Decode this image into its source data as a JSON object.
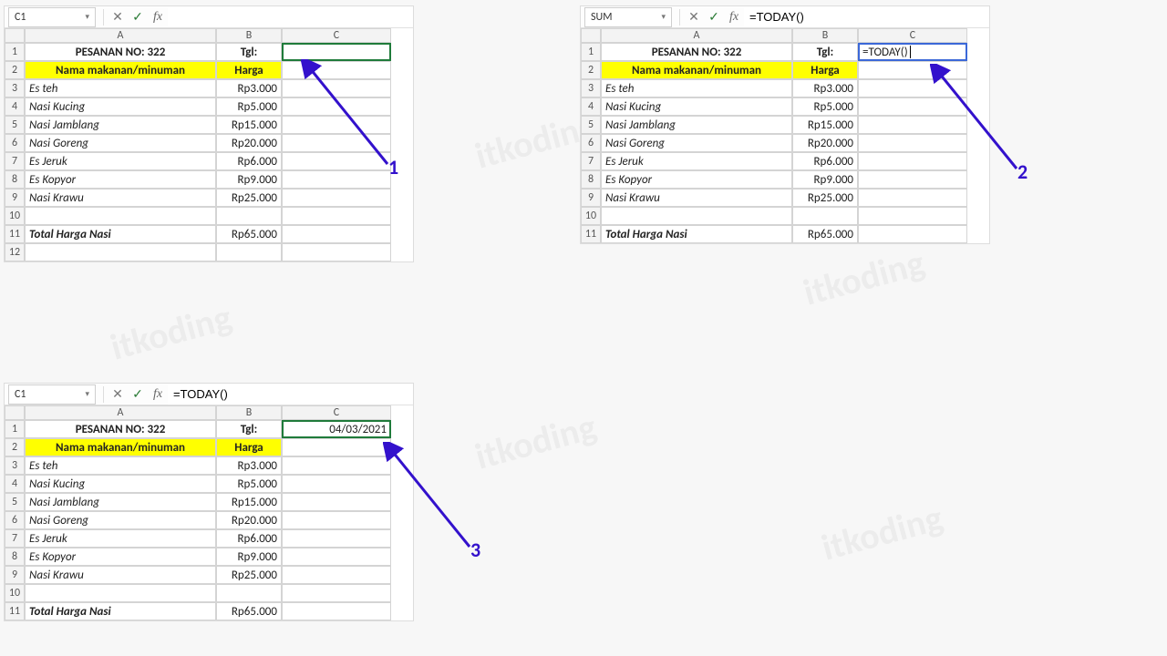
{
  "watermark": "itkoding",
  "panel1": {
    "namebox": "C1",
    "formula": "",
    "cols": [
      "A",
      "B",
      "C"
    ],
    "rows": [
      "1",
      "2",
      "3",
      "4",
      "5",
      "6",
      "7",
      "8",
      "9",
      "10",
      "11",
      "12"
    ],
    "r1": {
      "a": "PESANAN NO: 322",
      "b": "Tgl:",
      "c": ""
    },
    "r2": {
      "a": "Nama makanan/minuman",
      "b": "Harga"
    },
    "items": [
      {
        "n": "Es teh",
        "p": "Rp3.000"
      },
      {
        "n": "Nasi Kucing",
        "p": "Rp5.000"
      },
      {
        "n": "Nasi Jamblang",
        "p": "Rp15.000"
      },
      {
        "n": "Nasi Goreng",
        "p": "Rp20.000"
      },
      {
        "n": "Es Jeruk",
        "p": "Rp6.000"
      },
      {
        "n": "Es Kopyor",
        "p": "Rp9.000"
      },
      {
        "n": "Nasi Krawu",
        "p": "Rp25.000"
      }
    ],
    "total": {
      "label": "Total Harga Nasi",
      "value": "Rp65.000"
    }
  },
  "panel2": {
    "namebox": "SUM",
    "formula": "=TODAY()",
    "c1text": "=TODAY()",
    "cols": [
      "A",
      "B",
      "C"
    ],
    "rows": [
      "1",
      "2",
      "3",
      "4",
      "5",
      "6",
      "7",
      "8",
      "9",
      "10",
      "11"
    ]
  },
  "panel3": {
    "namebox": "C1",
    "formula": "=TODAY()",
    "c1text": "04/03/2021",
    "cols": [
      "A",
      "B",
      "C"
    ],
    "rows": [
      "1",
      "2",
      "3",
      "4",
      "5",
      "6",
      "7",
      "8",
      "9",
      "10",
      "11"
    ]
  },
  "labels": {
    "l1": "1",
    "l2": "2",
    "l3": "3"
  },
  "chart_data": null
}
